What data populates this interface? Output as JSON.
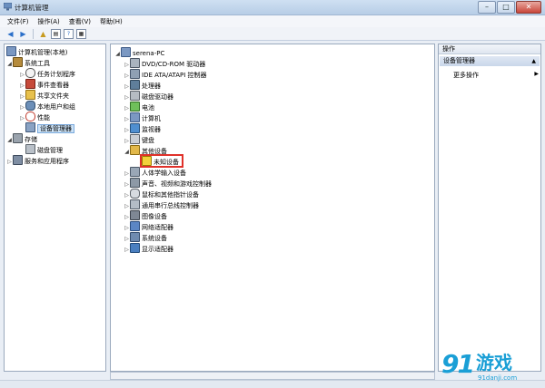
{
  "window": {
    "title": "计算机管理"
  },
  "menu": [
    "文件(F)",
    "操作(A)",
    "查看(V)",
    "帮助(H)"
  ],
  "tree": {
    "root": "计算机管理(本地)",
    "system_tools": "系统工具",
    "task_scheduler": "任务计划程序",
    "event_viewer": "事件查看器",
    "shared_folders": "共享文件夹",
    "local_users": "本地用户和组",
    "performance": "性能",
    "device_manager": "设备管理器",
    "storage": "存储",
    "disk_management": "磁盘管理",
    "services_apps": "服务和应用程序"
  },
  "devices": {
    "computer": "serena-PC",
    "items": [
      "DVD/CD-ROM 驱动器",
      "IDE ATA/ATAPI 控制器",
      "处理器",
      "磁盘驱动器",
      "电池",
      "计算机",
      "监视器",
      "键盘",
      "其他设备",
      "未知设备",
      "人体学输入设备",
      "声音、视频和游戏控制器",
      "鼠标和其他指针设备",
      "通用串行总线控制器",
      "图像设备",
      "网络适配器",
      "系统设备",
      "显示适配器"
    ]
  },
  "actions": {
    "header": "操作",
    "section": "设备管理器",
    "more": "更多操作"
  },
  "watermark": {
    "logo": "91",
    "name": "游戏",
    "url": "91danji.com"
  }
}
